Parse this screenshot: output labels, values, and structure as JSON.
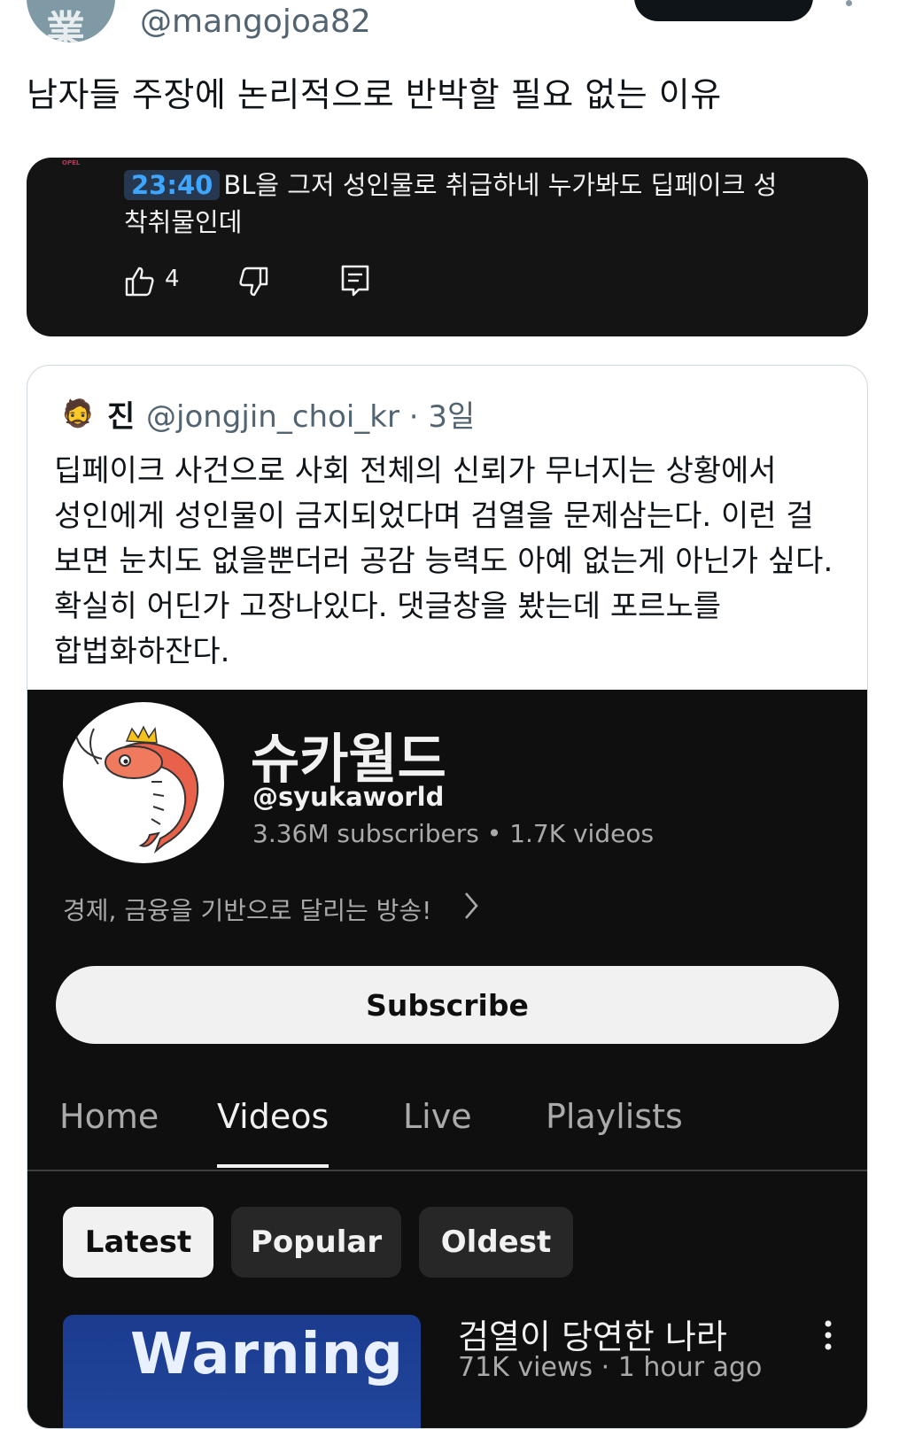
{
  "tweet": {
    "handle": "@mangojoa82",
    "text": "남자들 주장에 논리적으로 반박할 필요 없는 이유"
  },
  "comment": {
    "timestamp": "23:40",
    "line1": "BL을 그저 성인물로 취급하네 누가봐도 딥페이크 성",
    "line2": "착취물인데",
    "like_count": "4",
    "logo_text": "OPEL"
  },
  "quote": {
    "name": "진",
    "handle_and_time": "@jongjin_choi_kr · 3일",
    "avatar_emoji": "🧔",
    "body_lines": [
      "딥페이크 사건으로 사회 전체의 신뢰가 무너지는 상황에서",
      "성인에게 성인물이 금지되었다며 검열을 문제삼는다. 이런 걸",
      "보면 눈치도 없을뿐더러 공감 능력도 아예 없는게 아닌가 싶다.",
      "확실히 어딘가 고장나있다. 댓글창을 봤는데 포르노를",
      "합법화하잔다."
    ]
  },
  "youtube": {
    "channel_name": "슈카월드",
    "channel_handle": "@syukaworld",
    "stats": "3.36M subscribers  •  1.7K videos",
    "description": "경제, 금융을 기반으로 달리는 방송!",
    "subscribe_label": "Subscribe",
    "tabs": [
      "Home",
      "Videos",
      "Live",
      "Playlists"
    ],
    "active_tab": "Videos",
    "chips": [
      "Latest",
      "Popular",
      "Oldest"
    ],
    "active_chip": "Latest",
    "video": {
      "thumbnail_text": "Warning",
      "title": "검열이 당연한 나라",
      "meta": "71K views · 1 hour ago"
    }
  },
  "colors": {
    "twitter_text": "#0f1419",
    "twitter_secondary": "#536471",
    "youtube_bg": "#0f0f0f",
    "youtube_link": "#3ea6ff"
  },
  "icons": [
    "like-icon",
    "dislike-icon",
    "reply-icon",
    "chevron-right-icon",
    "kebab-menu-icon"
  ]
}
